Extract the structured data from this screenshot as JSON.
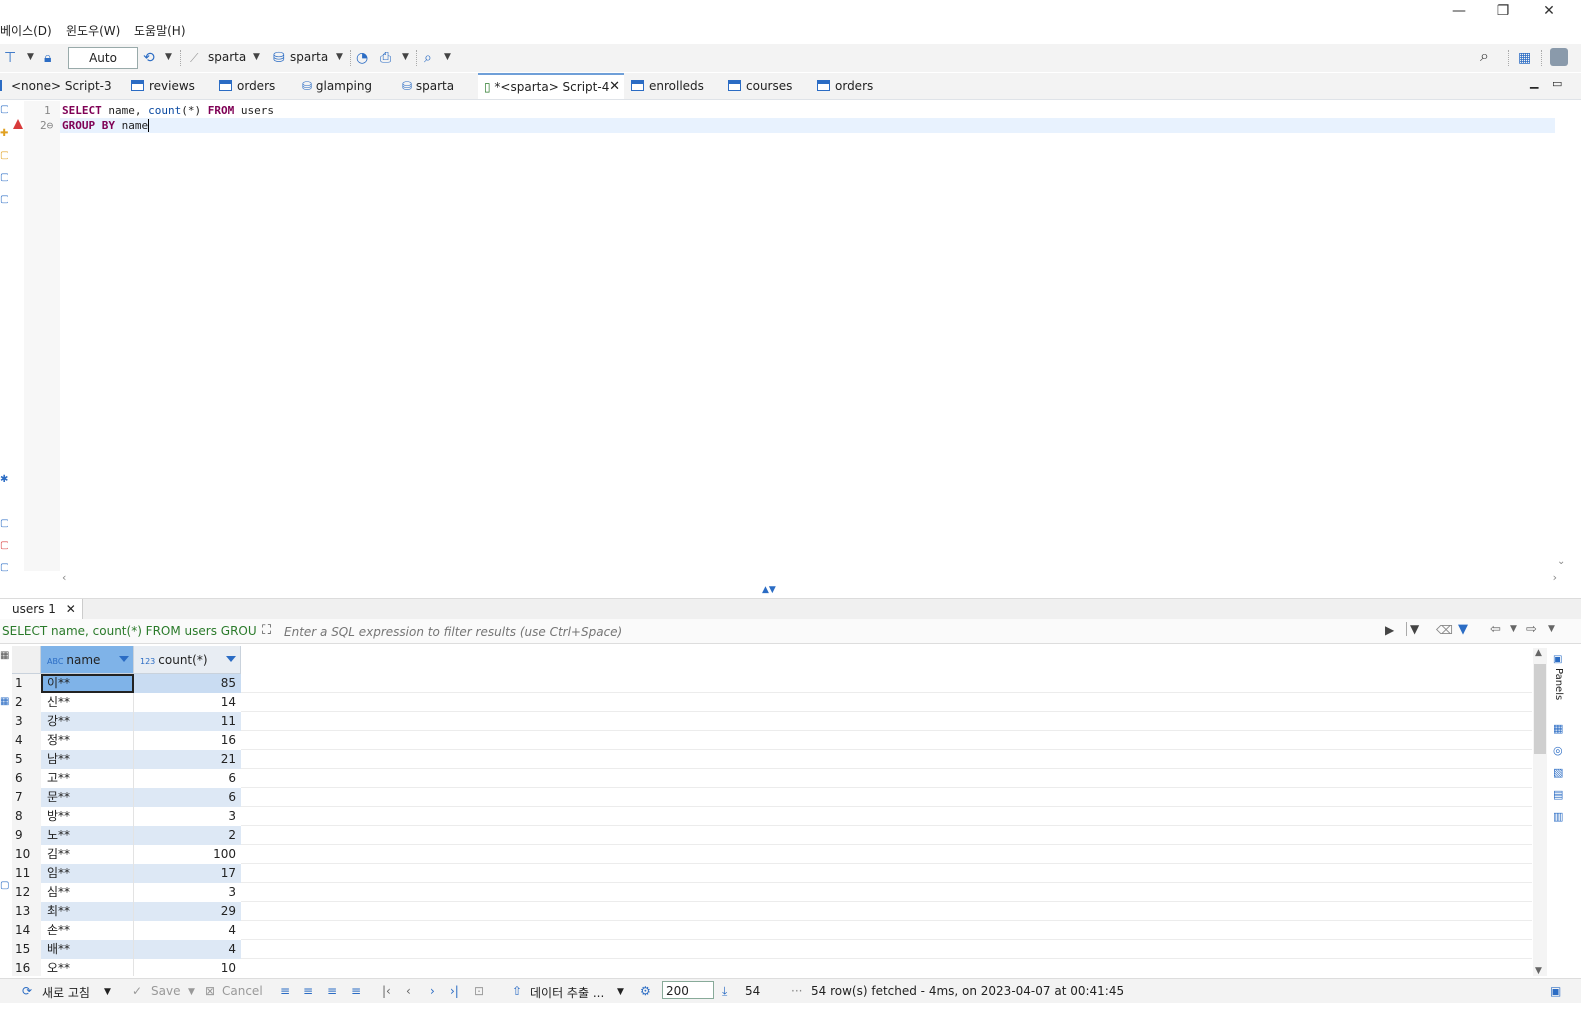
{
  "menu": {
    "items": [
      "베이스(D)",
      "윈도우(W)",
      "도움말(H)"
    ]
  },
  "window_controls": {
    "minimize": "—",
    "restore": "❐",
    "close": "✕"
  },
  "toolbar": {
    "commit_mode": "Auto",
    "datasource": "sparta",
    "schema": "sparta"
  },
  "tabs": [
    {
      "label": "<none> Script-3",
      "icon": "script-icon"
    },
    {
      "label": "reviews",
      "icon": "table-icon"
    },
    {
      "label": "orders",
      "icon": "table-icon"
    },
    {
      "label": "glamping",
      "icon": "database-icon"
    },
    {
      "label": "sparta",
      "icon": "database-icon"
    },
    {
      "label": "*<sparta> Script-4",
      "icon": "script-icon",
      "active": true
    },
    {
      "label": "enrolleds",
      "icon": "table-icon"
    },
    {
      "label": "courses",
      "icon": "table-icon"
    },
    {
      "label": "orders",
      "icon": "table-icon"
    }
  ],
  "editor": {
    "line_numbers": [
      "1",
      "2⊖"
    ],
    "line1": {
      "kw1": "SELECT",
      "t1": " name, ",
      "fn": "count",
      "t2": "(*) ",
      "kw2": "FROM",
      "t3": " users"
    },
    "line2": {
      "kw": "GROUP BY",
      "t": " name"
    }
  },
  "results": {
    "tab_label": "users 1",
    "query": "SELECT name, count(*) FROM users GROUP BY name",
    "filter_placeholder": "Enter a SQL expression to filter results (use Ctrl+Space)",
    "columns": [
      {
        "type": "ABC",
        "name": "name"
      },
      {
        "type": "123",
        "name": "count(*)"
      }
    ],
    "rows": [
      {
        "n": "1",
        "name": "이**",
        "count": "85"
      },
      {
        "n": "2",
        "name": "신**",
        "count": "14"
      },
      {
        "n": "3",
        "name": "강**",
        "count": "11"
      },
      {
        "n": "4",
        "name": "정**",
        "count": "16"
      },
      {
        "n": "5",
        "name": "남**",
        "count": "21"
      },
      {
        "n": "6",
        "name": "고**",
        "count": "6"
      },
      {
        "n": "7",
        "name": "문**",
        "count": "6"
      },
      {
        "n": "8",
        "name": "방**",
        "count": "3"
      },
      {
        "n": "9",
        "name": "노**",
        "count": "2"
      },
      {
        "n": "10",
        "name": "김**",
        "count": "100"
      },
      {
        "n": "11",
        "name": "임**",
        "count": "17"
      },
      {
        "n": "12",
        "name": "심**",
        "count": "3"
      },
      {
        "n": "13",
        "name": "최**",
        "count": "29"
      },
      {
        "n": "14",
        "name": "손**",
        "count": "4"
      },
      {
        "n": "15",
        "name": "배**",
        "count": "4"
      },
      {
        "n": "16",
        "name": "오**",
        "count": "10"
      }
    ],
    "side_panel_label": "Panels"
  },
  "status": {
    "refresh_label": "새로 고침",
    "save_label": "Save",
    "cancel_label": "Cancel",
    "export_label": "데이터 추출 ...",
    "fetch_size": "200",
    "row_count": "54",
    "message": "54 row(s) fetched - 4ms, on 2023-04-07 at 00:41:45"
  },
  "colors": {
    "accent": "#2b6cc4",
    "selected_header": "#7fb3e8",
    "alt_row": "#dde8f5",
    "keyword": "#7f0055",
    "error": "#d83b3b"
  }
}
